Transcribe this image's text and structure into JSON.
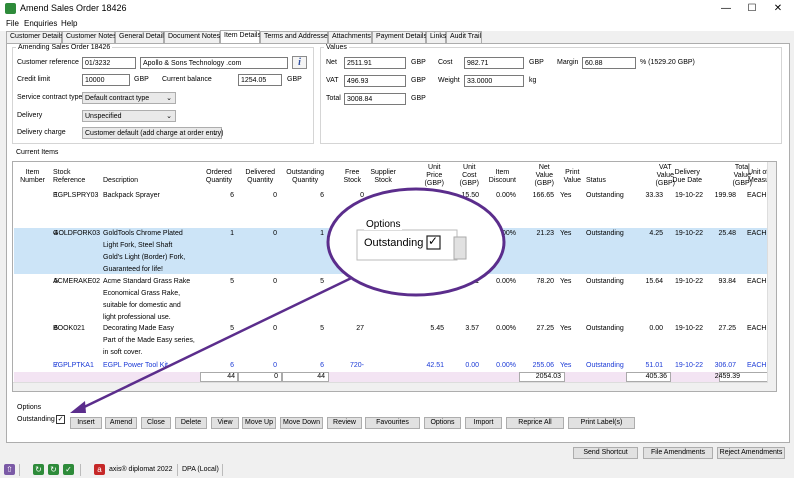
{
  "window": {
    "title": "Amend Sales Order 18426",
    "minimize": "—",
    "maximize": "☐",
    "close": "✕"
  },
  "menu": [
    "File",
    "Enquiries",
    "Help"
  ],
  "tabs": [
    "Customer Details",
    "Customer Notes",
    "General Details",
    "Document Notes",
    "Item Details",
    "Terms and Addresses",
    "Attachments",
    "Payment Details",
    "Links",
    "Audit Trail"
  ],
  "active_tab": "Item Details",
  "order": {
    "legend": "Amending Sales Order 18426",
    "customer_reference_label": "Customer reference",
    "customer_reference": "01/3232",
    "customer_name": "Apollo & Sons Technology .com",
    "credit_limit_label": "Credit limit",
    "credit_limit": "10000",
    "credit_currency": "GBP",
    "current_balance_label": "Current balance",
    "current_balance": "1254.05",
    "balance_currency": "GBP",
    "service_contract_label": "Service contract type",
    "service_contract": "Default contract type",
    "delivery_label": "Delivery",
    "delivery": "Unspecified",
    "delivery_charge_label": "Delivery charge",
    "delivery_charge": "Customer default (add charge at order entry)"
  },
  "values": {
    "legend": "Values",
    "net_label": "Net",
    "net": "2511.91",
    "net_cur": "GBP",
    "vat_label": "VAT",
    "vat": "496.93",
    "vat_cur": "GBP",
    "total_label": "Total",
    "total": "3008.84",
    "total_cur": "GBP",
    "cost_label": "Cost",
    "cost": "982.71",
    "cost_cur": "GBP",
    "weight_label": "Weight",
    "weight": "33.0000",
    "weight_unit": "kg",
    "margin_label": "Margin",
    "margin": "60.88",
    "margin_suffix": "% (1529.20 GBP)"
  },
  "grid": {
    "legend": "Current Items",
    "headers": [
      [
        "Item",
        "Number"
      ],
      [
        "Stock",
        "Reference"
      ],
      [
        "Description"
      ],
      [
        "Ordered",
        "Quantity"
      ],
      [
        "Delivered",
        "Quantity"
      ],
      [
        "Outstanding",
        "Quantity"
      ],
      [
        "Free",
        "Stock"
      ],
      [
        "Supplier",
        "Stock"
      ],
      [
        "Unit",
        "Price",
        "(GBP)"
      ],
      [
        "Unit",
        "Cost",
        "(GBP)"
      ],
      [
        "Item",
        "Discount"
      ],
      [
        "Net",
        "Value",
        "(GBP)"
      ],
      [
        "Print",
        "Value"
      ],
      [
        "Status"
      ],
      [
        "VAT",
        "Value",
        "(GBP)"
      ],
      [
        "Delivery",
        "Due Date"
      ],
      [
        "Total",
        "Value",
        "(GBP)"
      ],
      [
        "Unit of",
        "Measure"
      ]
    ],
    "rows": [
      {
        "num": "1",
        "ref": "EGPLSPRY03",
        "desc": [
          "Backpack Sprayer"
        ],
        "ord": "6",
        "del": "0",
        "out": "6",
        "free": "0",
        "sup": "",
        "uprice": "33.33",
        "ucost": "15.50",
        "disc": "0.00%",
        "net": "166.65",
        "print": "Yes",
        "status": "Outstanding",
        "vat": "33.33",
        "due": "19-10-22",
        "total": "199.98",
        "uom": "EACH",
        "selected": false,
        "blue": false
      },
      {
        "num": "4",
        "ref": "GOLDFORK03",
        "desc": [
          "GoldTools Chrome Plated",
          "Light Fork, Steel Shaft",
          "Gold's Light (Border) Fork,",
          "Guaranteed for life!"
        ],
        "ord": "1",
        "del": "0",
        "out": "1",
        "free": "",
        "sup": "",
        "uprice": "",
        "ucost": "12.74",
        "disc": "0.00%",
        "net": "21.23",
        "print": "Yes",
        "status": "Outstanding",
        "vat": "4.25",
        "due": "19-10-22",
        "total": "25.48",
        "uom": "EACH",
        "selected": true,
        "blue": false
      },
      {
        "num": "5",
        "ref": "ACMERAKE02",
        "desc": [
          "Acme Standard Grass Rake",
          "Economical Grass Rake,",
          "suitable for domestic and",
          "light professional use."
        ],
        "ord": "5",
        "del": "0",
        "out": "5",
        "free": "",
        "sup": "",
        "uprice": "",
        "ucost": "21",
        "disc": "0.00%",
        "net": "78.20",
        "print": "Yes",
        "status": "Outstanding",
        "vat": "15.64",
        "due": "19-10-22",
        "total": "93.84",
        "uom": "EACH",
        "selected": false,
        "blue": false
      },
      {
        "num": "6",
        "ref": "BOOK021",
        "desc": [
          "Decorating Made Easy",
          "Part of the Made Easy series,",
          "in soft cover."
        ],
        "ord": "5",
        "del": "0",
        "out": "5",
        "free": "27",
        "sup": "",
        "uprice": "5.45",
        "ucost": "3.57",
        "disc": "0.00%",
        "net": "27.25",
        "print": "Yes",
        "status": "Outstanding",
        "vat": "0.00",
        "due": "19-10-22",
        "total": "27.25",
        "uom": "EACH",
        "selected": false,
        "blue": false
      },
      {
        "num": "7",
        "ref": "EGPLPTKA1",
        "desc": [
          "EGPL Power Tool Kit",
          "Accessory Pack",
          "includes extension lead, RCD,"
        ],
        "ord": "6",
        "del": "0",
        "out": "6",
        "free": "720-",
        "sup": "",
        "uprice": "42.51",
        "ucost": "0.00",
        "disc": "0.00%",
        "net": "255.06",
        "print": "Yes",
        "status": "Outstanding",
        "vat": "51.01",
        "due": "19-10-22",
        "total": "306.07",
        "uom": "EACH",
        "selected": false,
        "blue": true
      }
    ],
    "totals": {
      "ord": "44",
      "del": "0",
      "out": "44",
      "net": "2054.03",
      "vat": "405.36",
      "total": "2459.39"
    }
  },
  "options": {
    "legend": "Options",
    "outstanding_label": "Outstanding",
    "outstanding_checked": true,
    "check_mark": "✓"
  },
  "callout": {
    "legend": "Options",
    "outstanding_label": "Outstanding",
    "check_mark": "✓"
  },
  "buttons": [
    "Insert",
    "Amend",
    "Close",
    "Delete",
    "View",
    "Move Up",
    "Move Down",
    "Review",
    "Favourites",
    "Options",
    "Import",
    "Reprice All",
    "Print Label(s)"
  ],
  "footer_buttons": [
    "Send Shortcut",
    "File Amendments",
    "Reject Amendments"
  ],
  "status": {
    "app": "axis® diplomat 2022",
    "db": "DPA (Local)"
  },
  "colors": {
    "accent": "#1b3ad6",
    "selected_row": "#cce4f7",
    "callout": "#5b2d8c"
  }
}
